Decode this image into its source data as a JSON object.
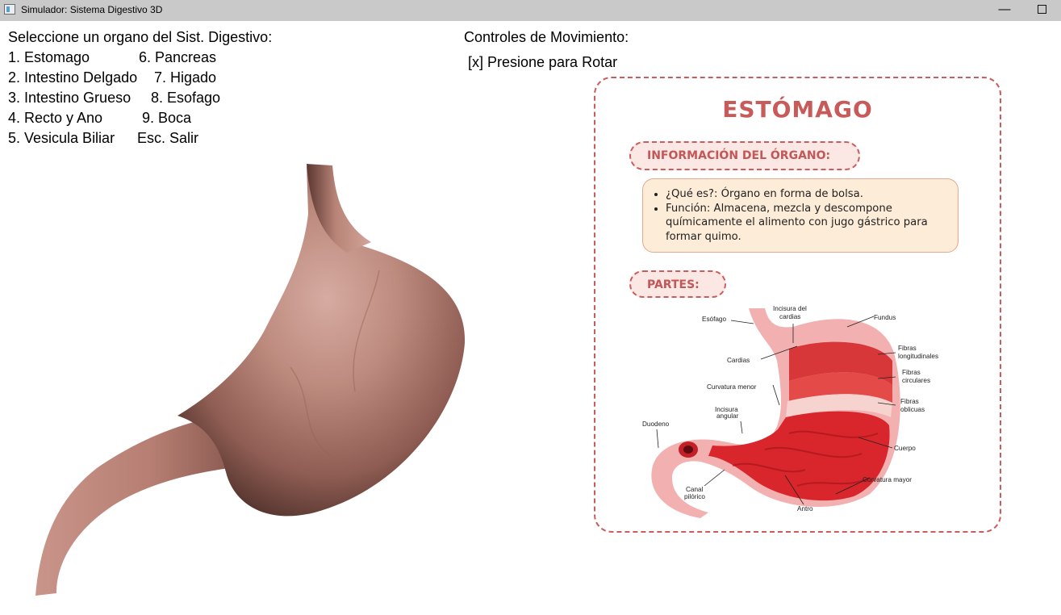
{
  "window": {
    "title": "Simulador: Sistema Digestivo 3D",
    "minimize_glyph": "—",
    "icon": "app-window-icon"
  },
  "menu": {
    "title": "Seleccione un organo del Sist. Digestivo:",
    "lines": [
      "1. Estomago",
      "6. Pancreas",
      "2. Intestino Delgado",
      "7. Higado",
      "3. Intestino Grueso",
      "8. Esofago",
      "4. Recto y Ano",
      "9. Boca",
      "5. Vesicula Biliar",
      "Esc. Salir"
    ]
  },
  "controls": {
    "title": "Controles de Movimiento:",
    "items": [
      "[x] Presione para Rotar"
    ]
  },
  "card": {
    "title": "ESTÓMAGO",
    "info_heading": "INFORMACIÓN DEL ÓRGANO:",
    "info_items": [
      "¿Qué es?: Órgano en forma de bolsa.",
      "Función: Almacena, mezcla y descompone químicamente el alimento con jugo gástrico para formar quimo."
    ],
    "parts_heading": "PARTES:",
    "diagram_labels": {
      "esofago": "Esófago",
      "incisura_cardias_1": "Incisura del",
      "incisura_cardias_2": "cardias",
      "fundus": "Fundus",
      "cardias": "Cardias",
      "fibras_long_1": "Fibras",
      "fibras_long_2": "longitudinales",
      "fibras_circ_1": "Fibras",
      "fibras_circ_2": "circulares",
      "curvatura_menor": "Curvatura menor",
      "fibras_obl_1": "Fibras",
      "fibras_obl_2": "oblicuas",
      "incisura_angular_1": "Incisura",
      "incisura_angular_2": "angular",
      "duodeno": "Duodeno",
      "cuerpo": "Cuerpo",
      "curvatura_mayor": "Curvatura mayor",
      "canal_pilorico_1": "Canal",
      "canal_pilorico_2": "pilórico",
      "antro": "Antro"
    }
  },
  "colors": {
    "accent": "#c95a5a",
    "info_box_bg": "#fdecd7",
    "model_skin": "#b87f73"
  }
}
